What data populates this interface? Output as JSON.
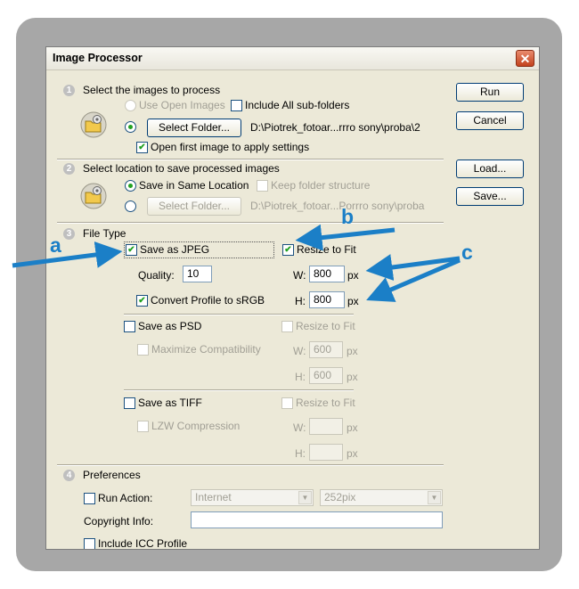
{
  "window": {
    "title": "Image Processor",
    "close": "✕"
  },
  "section1": {
    "number": "1",
    "heading": "Select the images to process",
    "use_open_images": "Use Open Images",
    "include_subfolders": "Include All sub-folders",
    "select_folder": "Select Folder...",
    "path": "D:\\Piotrek_fotoar...rrro sony\\proba\\2",
    "open_first_image": "Open first image to apply settings"
  },
  "section2": {
    "number": "2",
    "heading": "Select location to save processed images",
    "save_same": "Save in Same Location",
    "keep_structure": "Keep folder structure",
    "select_folder": "Select Folder...",
    "path": "D:\\Piotrek_fotoar...Porrro sony\\proba"
  },
  "section3": {
    "number": "3",
    "heading": "File Type",
    "jpeg": {
      "save_as": "Save as JPEG",
      "resize": "Resize to Fit",
      "quality_label": "Quality:",
      "quality_value": "10",
      "w_label": "W:",
      "w_value": "800",
      "h_label": "H:",
      "h_value": "800",
      "unit": "px",
      "convert_profile": "Convert Profile to sRGB"
    },
    "psd": {
      "save_as": "Save as PSD",
      "resize": "Resize to Fit",
      "maximize": "Maximize Compatibility",
      "w_label": "W:",
      "w_value": "600",
      "h_label": "H:",
      "h_value": "600",
      "unit": "px"
    },
    "tiff": {
      "save_as": "Save as TIFF",
      "resize": "Resize to Fit",
      "lzw": "LZW Compression",
      "w_label": "W:",
      "h_label": "H:",
      "unit": "px"
    }
  },
  "section4": {
    "number": "4",
    "heading": "Preferences",
    "run_action": "Run Action:",
    "action_set": "Internet",
    "action": "252pix",
    "copyright": "Copyright Info:",
    "include_icc": "Include ICC Profile"
  },
  "buttons": {
    "run": "Run",
    "cancel": "Cancel",
    "load": "Load...",
    "save": "Save..."
  },
  "annotations": {
    "a": "a",
    "b": "b",
    "c": "c"
  },
  "check_mark": "✔",
  "icon_names": [
    "folder-gear-icon",
    "folder-gear-icon"
  ],
  "colors": {
    "annotation": "#1b7fc7",
    "check": "#21a121",
    "frame": "#a7a7a7",
    "dialog": "#ece9d8"
  }
}
